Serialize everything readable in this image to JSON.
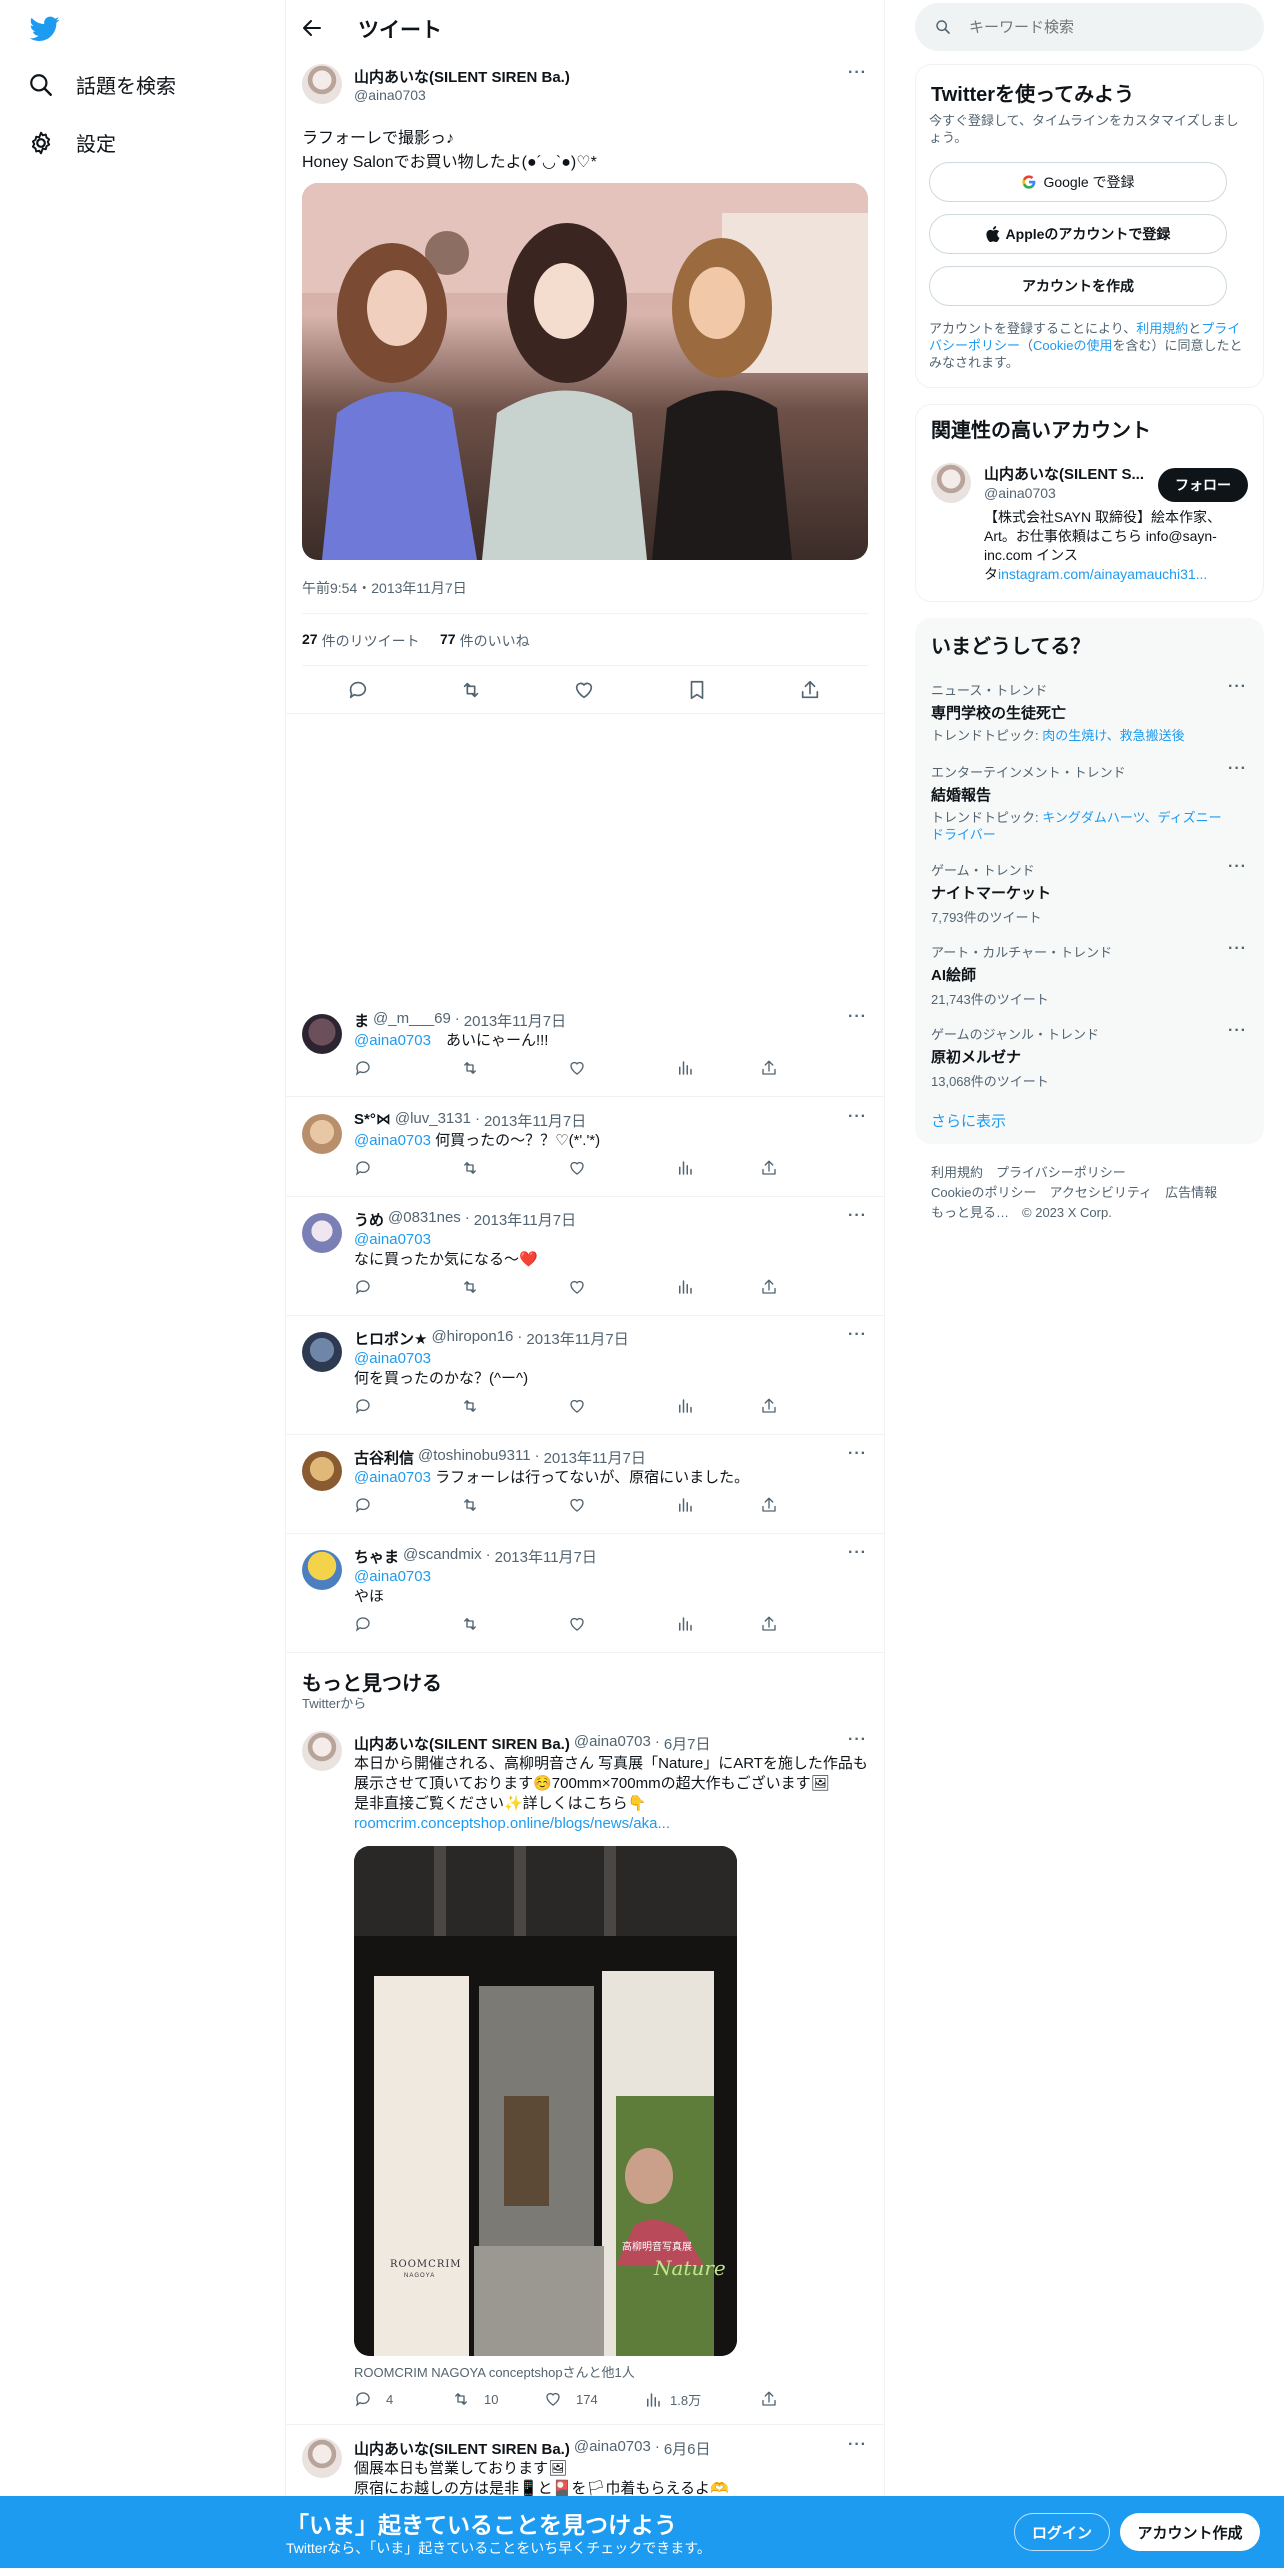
{
  "nav": {
    "explore_label": "話題を検索",
    "settings_label": "設定"
  },
  "header": {
    "title": "ツイート"
  },
  "tweet": {
    "author_name": "山内あいな(SILENT SIREN Ba.)",
    "author_handle": "@aina0703",
    "text_line1": "ラフォーレで撮影っ♪",
    "text_line2": "Honey Salonでお買い物したよ(●´◡`●)♡*",
    "timestamp": "午前9:54・2013年11月7日",
    "retweets_count": "27",
    "retweets_label": "件のリツイート",
    "likes_count": "77",
    "likes_label": "件のいいね"
  },
  "replies": [
    {
      "name": "ま",
      "handle": "@_m___69",
      "date": "2013年11月7日",
      "mention": "@aina0703",
      "text": "　あいにゃーん!!!"
    },
    {
      "name": "S*°⋈",
      "handle": "@luv_3131",
      "date": "2013年11月7日",
      "mention": "@aina0703",
      "text": " 何買ったの〜？？♡(*'.'*)"
    },
    {
      "name": "うめ",
      "handle": "@0831nes",
      "date": "2013年11月7日",
      "mention": "@aina0703",
      "text": "なに買ったか気になる～❤️"
    },
    {
      "name": "ヒロポン★",
      "handle": "@hiropon16",
      "date": "2013年11月7日",
      "mention": "@aina0703",
      "text": "何を買ったのかな？(^ー^)"
    },
    {
      "name": "古谷利信",
      "handle": "@toshinobu9311",
      "date": "2013年11月7日",
      "mention": "@aina0703",
      "text": " ラフォーレは行ってないが、原宿にいました。"
    },
    {
      "name": "ちゃま",
      "handle": "@scandmix",
      "date": "2013年11月7日",
      "mention": "@aina0703",
      "text": "やほ"
    }
  ],
  "discover": {
    "title": "もっと見つける",
    "subtitle": "Twitterから",
    "tweet1": {
      "name": "山内あいな(SILENT SIREN Ba.)",
      "handle": "@aina0703",
      "date": "6月7日",
      "line1": "本日から開催される、高柳明音さん 写真展「Nature」にARTを施した作品も",
      "line2": "展示させて頂いております☺️700mm×700mmの超大作もございます🖼",
      "line3": "是非直接ご覧ください✨詳しくはこちら👇",
      "link": "roomcrim.conceptshop.online/blogs/news/aka...",
      "media_caption": "ROOMCRIM NAGOYA conceptshopさんと他1人",
      "image_text_top": "高柳明音写真展",
      "image_text_art": "Nature",
      "image_text_shop": "ROOMCRIM",
      "image_text_city": "NAGOYA",
      "replies": "4",
      "retweets": "10",
      "likes": "174",
      "views": "1.8万"
    },
    "tweet2": {
      "name": "山内あいな(SILENT SIREN Ba.)",
      "handle": "@aina0703",
      "date": "6月6日",
      "line1": "個展本日も営業しております🖼",
      "line2": "原宿にお越しの方は是非📱と🎴を🏳巾着もらえるよ🫶"
    }
  },
  "sidebar": {
    "search_placeholder": "キーワード検索",
    "signup": {
      "title": "Twitterを使ってみよう",
      "desc": "今すぐ登録して、タイムラインをカスタマイズしましょう。",
      "google_label": "Google で登録",
      "apple_label": "Appleのアカウントで登録",
      "create_label": "アカウントを作成",
      "legal_pre": "アカウントを登録することにより、",
      "legal_terms": "利用規約",
      "legal_and": "と",
      "legal_privacy": "プライバシーポリシー",
      "legal_paren_open": "（",
      "legal_cookie": "Cookieの使用",
      "legal_post": "を含む）に同意したとみなされます。"
    },
    "related": {
      "title": "関連性の高いアカウント",
      "name": "山内あいな(SILENT S...",
      "handle": "@aina0703",
      "follow_label": "フォロー",
      "bio_line1": "【株式会社SAYN 取締役】絵本作家、",
      "bio_line2": "Art。お仕事依頼はこちら info@sayn-",
      "bio_line3": "inc.com インス",
      "bio_line4_pre": "タ",
      "bio_link": "instagram.com/ainayamauchi31..."
    },
    "trends": {
      "title": "いまどうしてる？",
      "items": [
        {
          "cat": "ニュース・トレンド",
          "name": "専門学校の生徒死亡",
          "sub_pre": "トレンドトピック: ",
          "sub_links": "肉の生焼け、救急搬送後",
          "count": ""
        },
        {
          "cat": "エンターテインメント・トレンド",
          "name": "結婚報告",
          "sub_pre": "トレンドトピック: ",
          "sub_links": "キングダムハーツ、ディズニードライバー",
          "count": ""
        },
        {
          "cat": "ゲーム・トレンド",
          "name": "ナイトマーケット",
          "sub_pre": "",
          "sub_links": "",
          "count": "7,793件のツイート"
        },
        {
          "cat": "アート・カルチャー・トレンド",
          "name": "AI絵師",
          "sub_pre": "",
          "sub_links": "",
          "count": "21,743件のツイート"
        },
        {
          "cat": "ゲームのジャンル・トレンド",
          "name": "原初メルゼナ",
          "sub_pre": "",
          "sub_links": "",
          "count": "13,068件のツイート"
        }
      ],
      "more_label": "さらに表示"
    },
    "footer": {
      "terms": "利用規約",
      "privacy": "プライバシーポリシー",
      "cookie": "Cookieのポリシー",
      "access": "アクセシビリティ",
      "ads": "広告情報",
      "more": "もっと見る…",
      "copyright": "© 2023 X Corp."
    }
  },
  "bottom_bar": {
    "title": "「いま」起きていることを見つけよう",
    "subtitle": "Twitterなら、「いま」起きていることをいち早くチェックできます。",
    "login_label": "ログイン",
    "signup_label": "アカウント作成"
  },
  "colors": {
    "brand": "#1d9bf0",
    "text": "#0f1419",
    "muted": "#536471",
    "border": "#eff3f4"
  }
}
